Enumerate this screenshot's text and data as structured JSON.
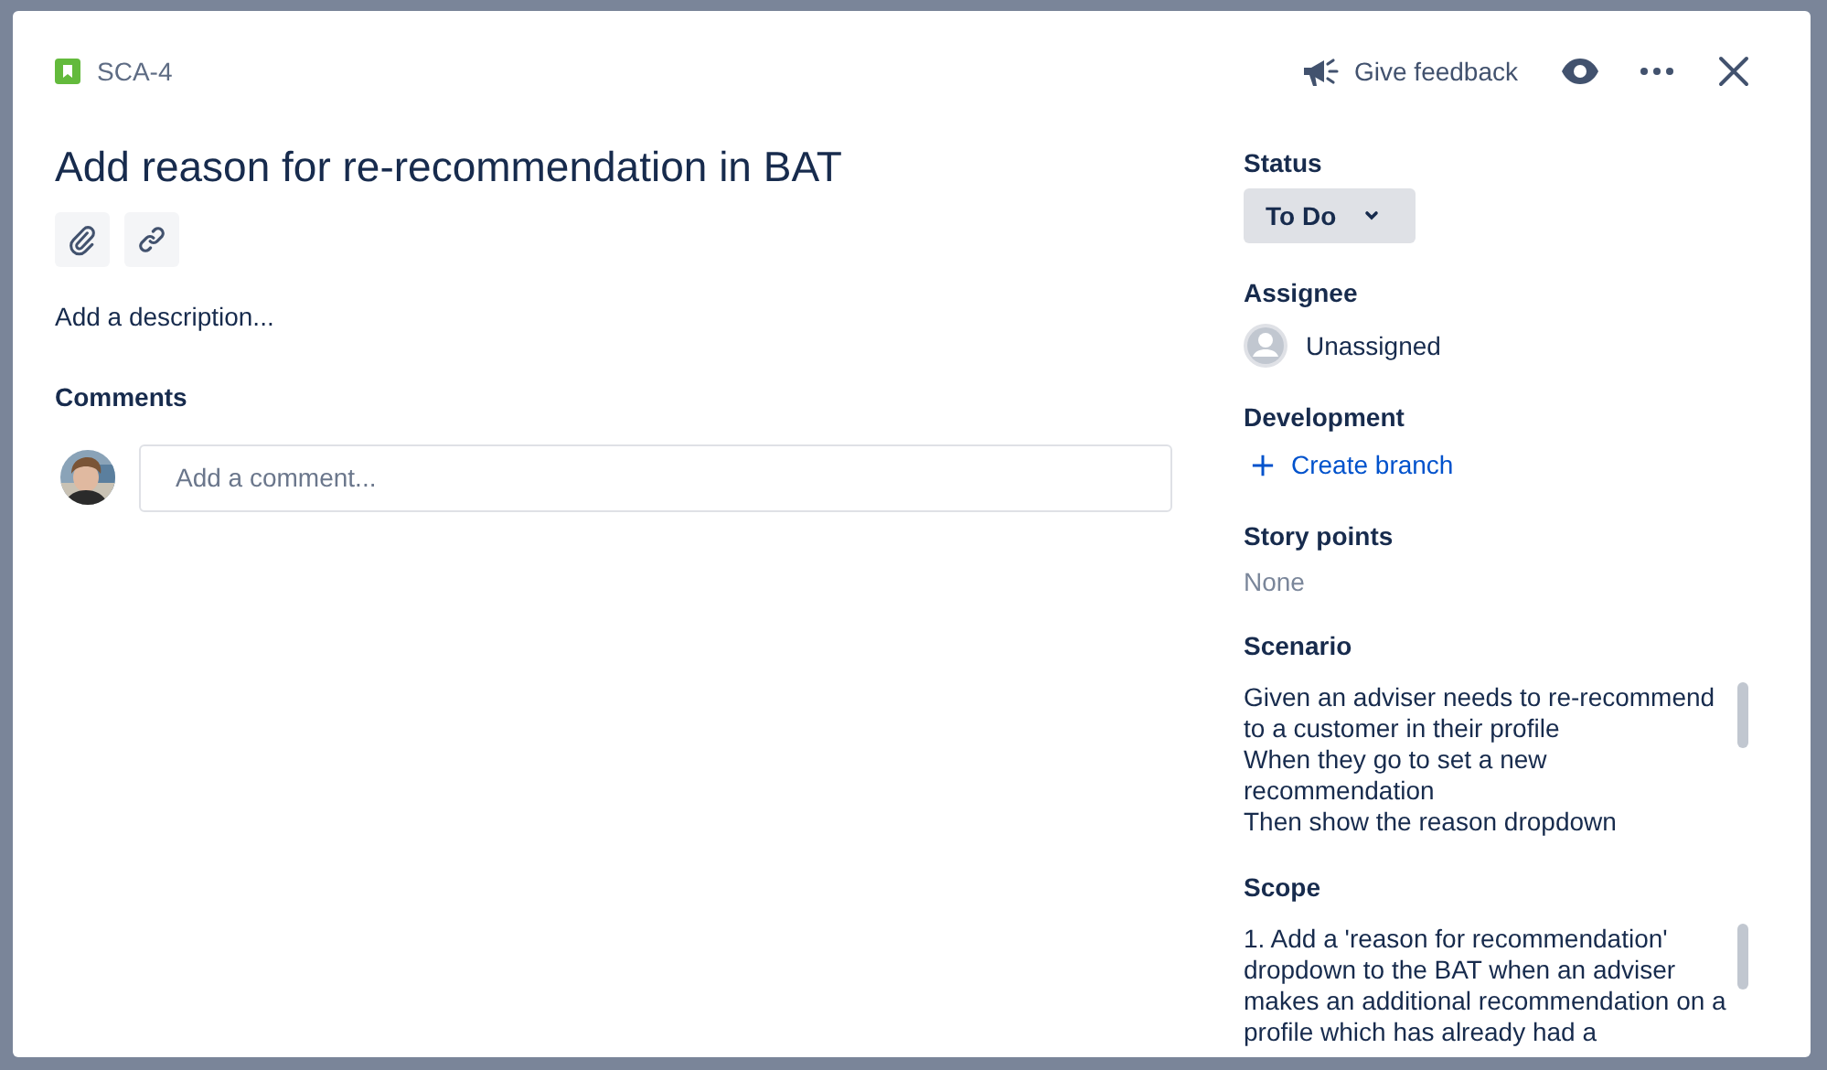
{
  "issue": {
    "key": "SCA-4",
    "title": "Add reason for re-recommendation in BAT"
  },
  "header": {
    "feedback": "Give feedback"
  },
  "description": {
    "placeholder": "Add a description..."
  },
  "comments": {
    "heading": "Comments",
    "placeholder": "Add a comment..."
  },
  "fields": [
    {
      "kind": "status",
      "label": "Status",
      "value": "To Do"
    },
    {
      "kind": "user",
      "label": "Assignee",
      "value": "Unassigned"
    },
    {
      "kind": "action",
      "label": "Development",
      "value": "Create branch"
    },
    {
      "kind": "empty",
      "label": "Story points",
      "value": "None"
    },
    {
      "kind": "text",
      "label": "Scenario",
      "value": "Given an adviser needs to re-recommend to a customer in their profile\nWhen they go to set a new recommendation\nThen show the reason dropdown"
    },
    {
      "kind": "text",
      "label": "Scope",
      "value": "1. Add a 'reason for recommendation' dropdown to the BAT when an adviser makes an additional recommendation on a profile which has already had a"
    }
  ]
}
